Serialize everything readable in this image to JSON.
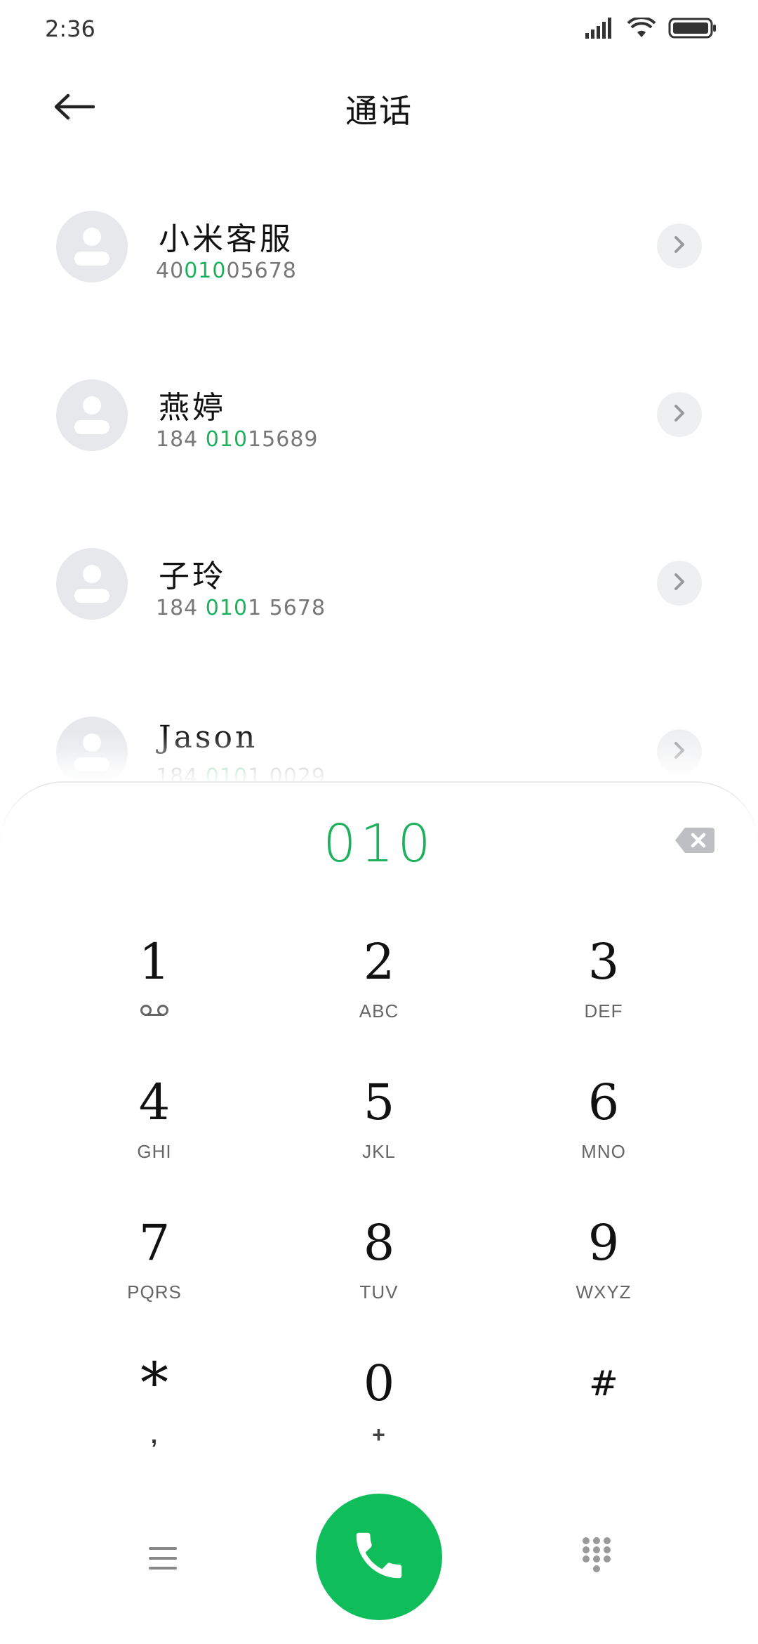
{
  "status_bar": {
    "time": "2:36",
    "icons": [
      "signal-icon",
      "wifi-icon",
      "battery-icon"
    ]
  },
  "header": {
    "title": "通话",
    "back_icon": "arrow-left-icon"
  },
  "contacts": [
    {
      "name": "小米客服",
      "number_pre": "40",
      "number_hl": "010",
      "number_post": "05678"
    },
    {
      "name": "燕婷",
      "number_pre": "184 ",
      "number_hl": "010",
      "number_post": "15689"
    },
    {
      "name": "子玲",
      "number_pre": "184 ",
      "number_hl": "010",
      "number_post": "1 5678"
    },
    {
      "name": "Jason",
      "number_pre": "184 ",
      "number_hl": "010",
      "number_post": "1 0029"
    }
  ],
  "dialer": {
    "input": "010",
    "keys": [
      {
        "digit": "1",
        "letters": "ꝏ"
      },
      {
        "digit": "2",
        "letters": "ABC"
      },
      {
        "digit": "3",
        "letters": "DEF"
      },
      {
        "digit": "4",
        "letters": "GHI"
      },
      {
        "digit": "5",
        "letters": "JKL"
      },
      {
        "digit": "6",
        "letters": "MNO"
      },
      {
        "digit": "7",
        "letters": "PQRS"
      },
      {
        "digit": "8",
        "letters": "TUV"
      },
      {
        "digit": "9",
        "letters": "WXYZ"
      },
      {
        "digit": "*",
        "letters": ","
      },
      {
        "digit": "0",
        "letters": "+"
      },
      {
        "digit": "#",
        "letters": ""
      }
    ]
  },
  "colors": {
    "accent": "#1db15c",
    "call_button": "#10bd5b",
    "avatar_bg": "#e6e8eb"
  }
}
